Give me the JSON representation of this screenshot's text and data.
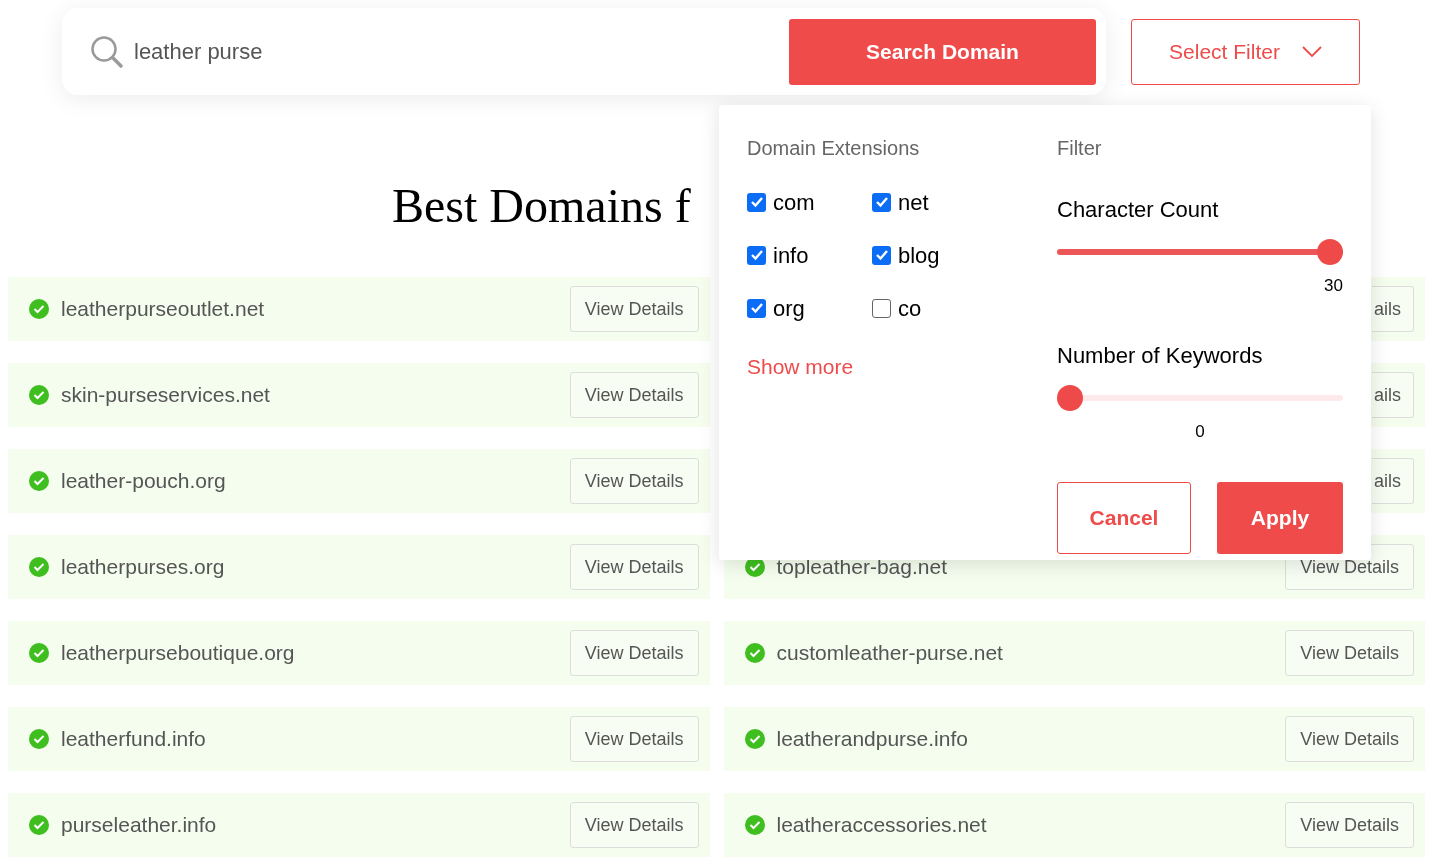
{
  "search": {
    "value": "leather purse",
    "button": "Search Domain"
  },
  "filter_button": {
    "label": "Select Filter",
    "expanded": true
  },
  "heading": "Best Domains f",
  "results_left": [
    {
      "domain": "leatherpurseoutlet.net",
      "action": "View Details"
    },
    {
      "domain": "skin-purseservices.net",
      "action": "View Details"
    },
    {
      "domain": "leather-pouch.org",
      "action": "View Details"
    },
    {
      "domain": "leatherpurses.org",
      "action": "View Details"
    },
    {
      "domain": "leatherpurseboutique.org",
      "action": "View Details"
    },
    {
      "domain": "leatherfund.info",
      "action": "View Details"
    },
    {
      "domain": "purseleather.info",
      "action": "View Details"
    }
  ],
  "results_right": [
    {
      "action": "ails"
    },
    {
      "action": "ails"
    },
    {
      "action": "ails"
    },
    {
      "domain": "topleather-bag.net",
      "action": "View Details"
    },
    {
      "domain": "customleather-purse.net",
      "action": "View Details"
    },
    {
      "domain": "leatherandpurse.info",
      "action": "View Details"
    },
    {
      "domain": "leatheraccessories.net",
      "action": "View Details"
    }
  ],
  "filter_panel": {
    "extensions_title": "Domain Extensions",
    "extensions": [
      {
        "label": "com",
        "checked": true
      },
      {
        "label": "net",
        "checked": true
      },
      {
        "label": "info",
        "checked": true
      },
      {
        "label": "blog",
        "checked": true
      },
      {
        "label": "org",
        "checked": true
      },
      {
        "label": "co",
        "checked": false
      }
    ],
    "show_more": "Show more",
    "filter_title": "Filter",
    "sliders": [
      {
        "label": "Character Count",
        "level": 1,
        "reading": "30"
      },
      {
        "label": "Number of Keywords",
        "level": 0,
        "reading": "0"
      }
    ],
    "buttons": [
      {
        "label": "Cancel",
        "kind": "secondary"
      },
      {
        "label": "Apply",
        "kind": "primary"
      }
    ]
  }
}
